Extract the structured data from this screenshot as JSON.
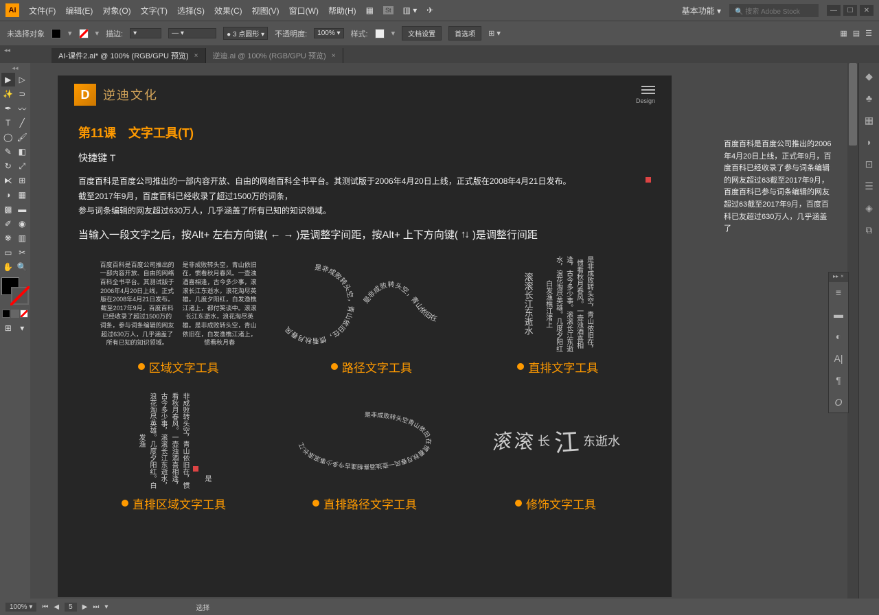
{
  "app": {
    "logo": "Ai"
  },
  "menu": [
    "文件(F)",
    "编辑(E)",
    "对象(O)",
    "文字(T)",
    "选择(S)",
    "效果(C)",
    "视图(V)",
    "窗口(W)",
    "帮助(H)"
  ],
  "workspace": "基本功能",
  "stock_search_placeholder": "搜索 Adobe Stock",
  "optbar": {
    "noSelection": "未选择对象",
    "stroke": "描边:",
    "strokeVal": "",
    "profile": "3 点圆形",
    "opacity": "不透明度:",
    "opacityVal": "100%",
    "style": "样式:",
    "docSetup": "文档设置",
    "prefs": "首选项"
  },
  "tabs": [
    {
      "label": "AI-课件2.ai* @ 100% (RGB/GPU 预览)",
      "active": true
    },
    {
      "label": "逆迪.ai @ 100% (RGB/GPU 预览)",
      "active": false
    }
  ],
  "artboard": {
    "brand": "逆迪文化",
    "design": "Design",
    "lesson": "第11课　文字工具(T)",
    "shortcut": "快捷键 T",
    "para1": "百度百科是百度公司推出的一部内容开放、自由的网络百科全书平台。其测试版于2006年4月20日上线，正式版在2008年4月21日发布。",
    "para2": "截至2017年9月，百度百科已经收录了超过1500万的词条，",
    "para3": "参与词条编辑的网友超过630万人，几乎涵盖了所有已知的知识领域。",
    "hint_pre": "当输入一段文字之后，按Alt+ 左右方向键(",
    "hint_mid": ")是调整字间距，按Alt+ 上下方向键(",
    "hint_post": ")是调整行间距",
    "areaTxt": "百度百科是百度公司推出的一部内容开放、自由的网络百科全书平台。其测试版于2006年4月20日上线，正式版在2008年4月21日发布。截至2017年9月，百度百科已经收录了超过1500万的词条，参与词条编辑的网友超过630万人，几乎涵盖了所有已知的知识领域。",
    "areaTxt2": "是非成败转头空，青山依旧在，惯看秋月春风。一壶浊酒喜相逢，古今多少事，滚滚长江东逝水，浪花淘尽英雄。几度夕阳红，白发渔樵江渚上，都付笑谈中。滚滚长江东逝水，浪花淘尽英雄。是非成败转头空，青山依旧在，白发渔樵江渚上，惯看秋月春",
    "circleTxt": "是非成败转头空，青山依旧在，惯看秋月春风",
    "waveTxt": "是非成败转头空，青山依旧在",
    "vertTxt1": "滚滚长江东逝水",
    "vertTxt2": "是非成败转头空，青山依旧在，惯看秋月春风。一壶浊酒喜相逢，古今多少事。滚滚长江东逝水，浪花淘尽英雄。几度夕阳红白发渔樵江渚上",
    "vertArea": "非成败转头空，青山依旧在，惯看秋月春风。一壶浊酒喜相逢，古今多少事，滚滚长江东逝水，浪花淘尽英雄。几度夕阳红。白发渔",
    "vertAreaOver": "是",
    "ellipseTxt": "是非成败转头空青山依旧在惯看秋月春风一壶浊酒喜相逢古今多少事滚滚长江",
    "decorate": {
      "c1": "滚",
      "c2": "滚",
      "c3": "长",
      "c4": "江",
      "c5": "东逝水"
    },
    "labels": {
      "area": "区域文字工具",
      "path": "路径文字工具",
      "vert": "直排文字工具",
      "vertArea": "直排区域文字工具",
      "vertPath": "直排路径文字工具",
      "touch": "修饰文字工具"
    }
  },
  "overflow": "百度百科是百度公司推出的2006年4月20日上线，正式年9月，百度百科已经收录了参与词条编辑的网友超过63截至2017年9月，百度百科已参与词条编辑的网友超过63截至2017年9月，百度百科已友超过630万人，几乎涵盖了",
  "status": {
    "zoom": "100%",
    "page": "5",
    "sel": "选择"
  }
}
